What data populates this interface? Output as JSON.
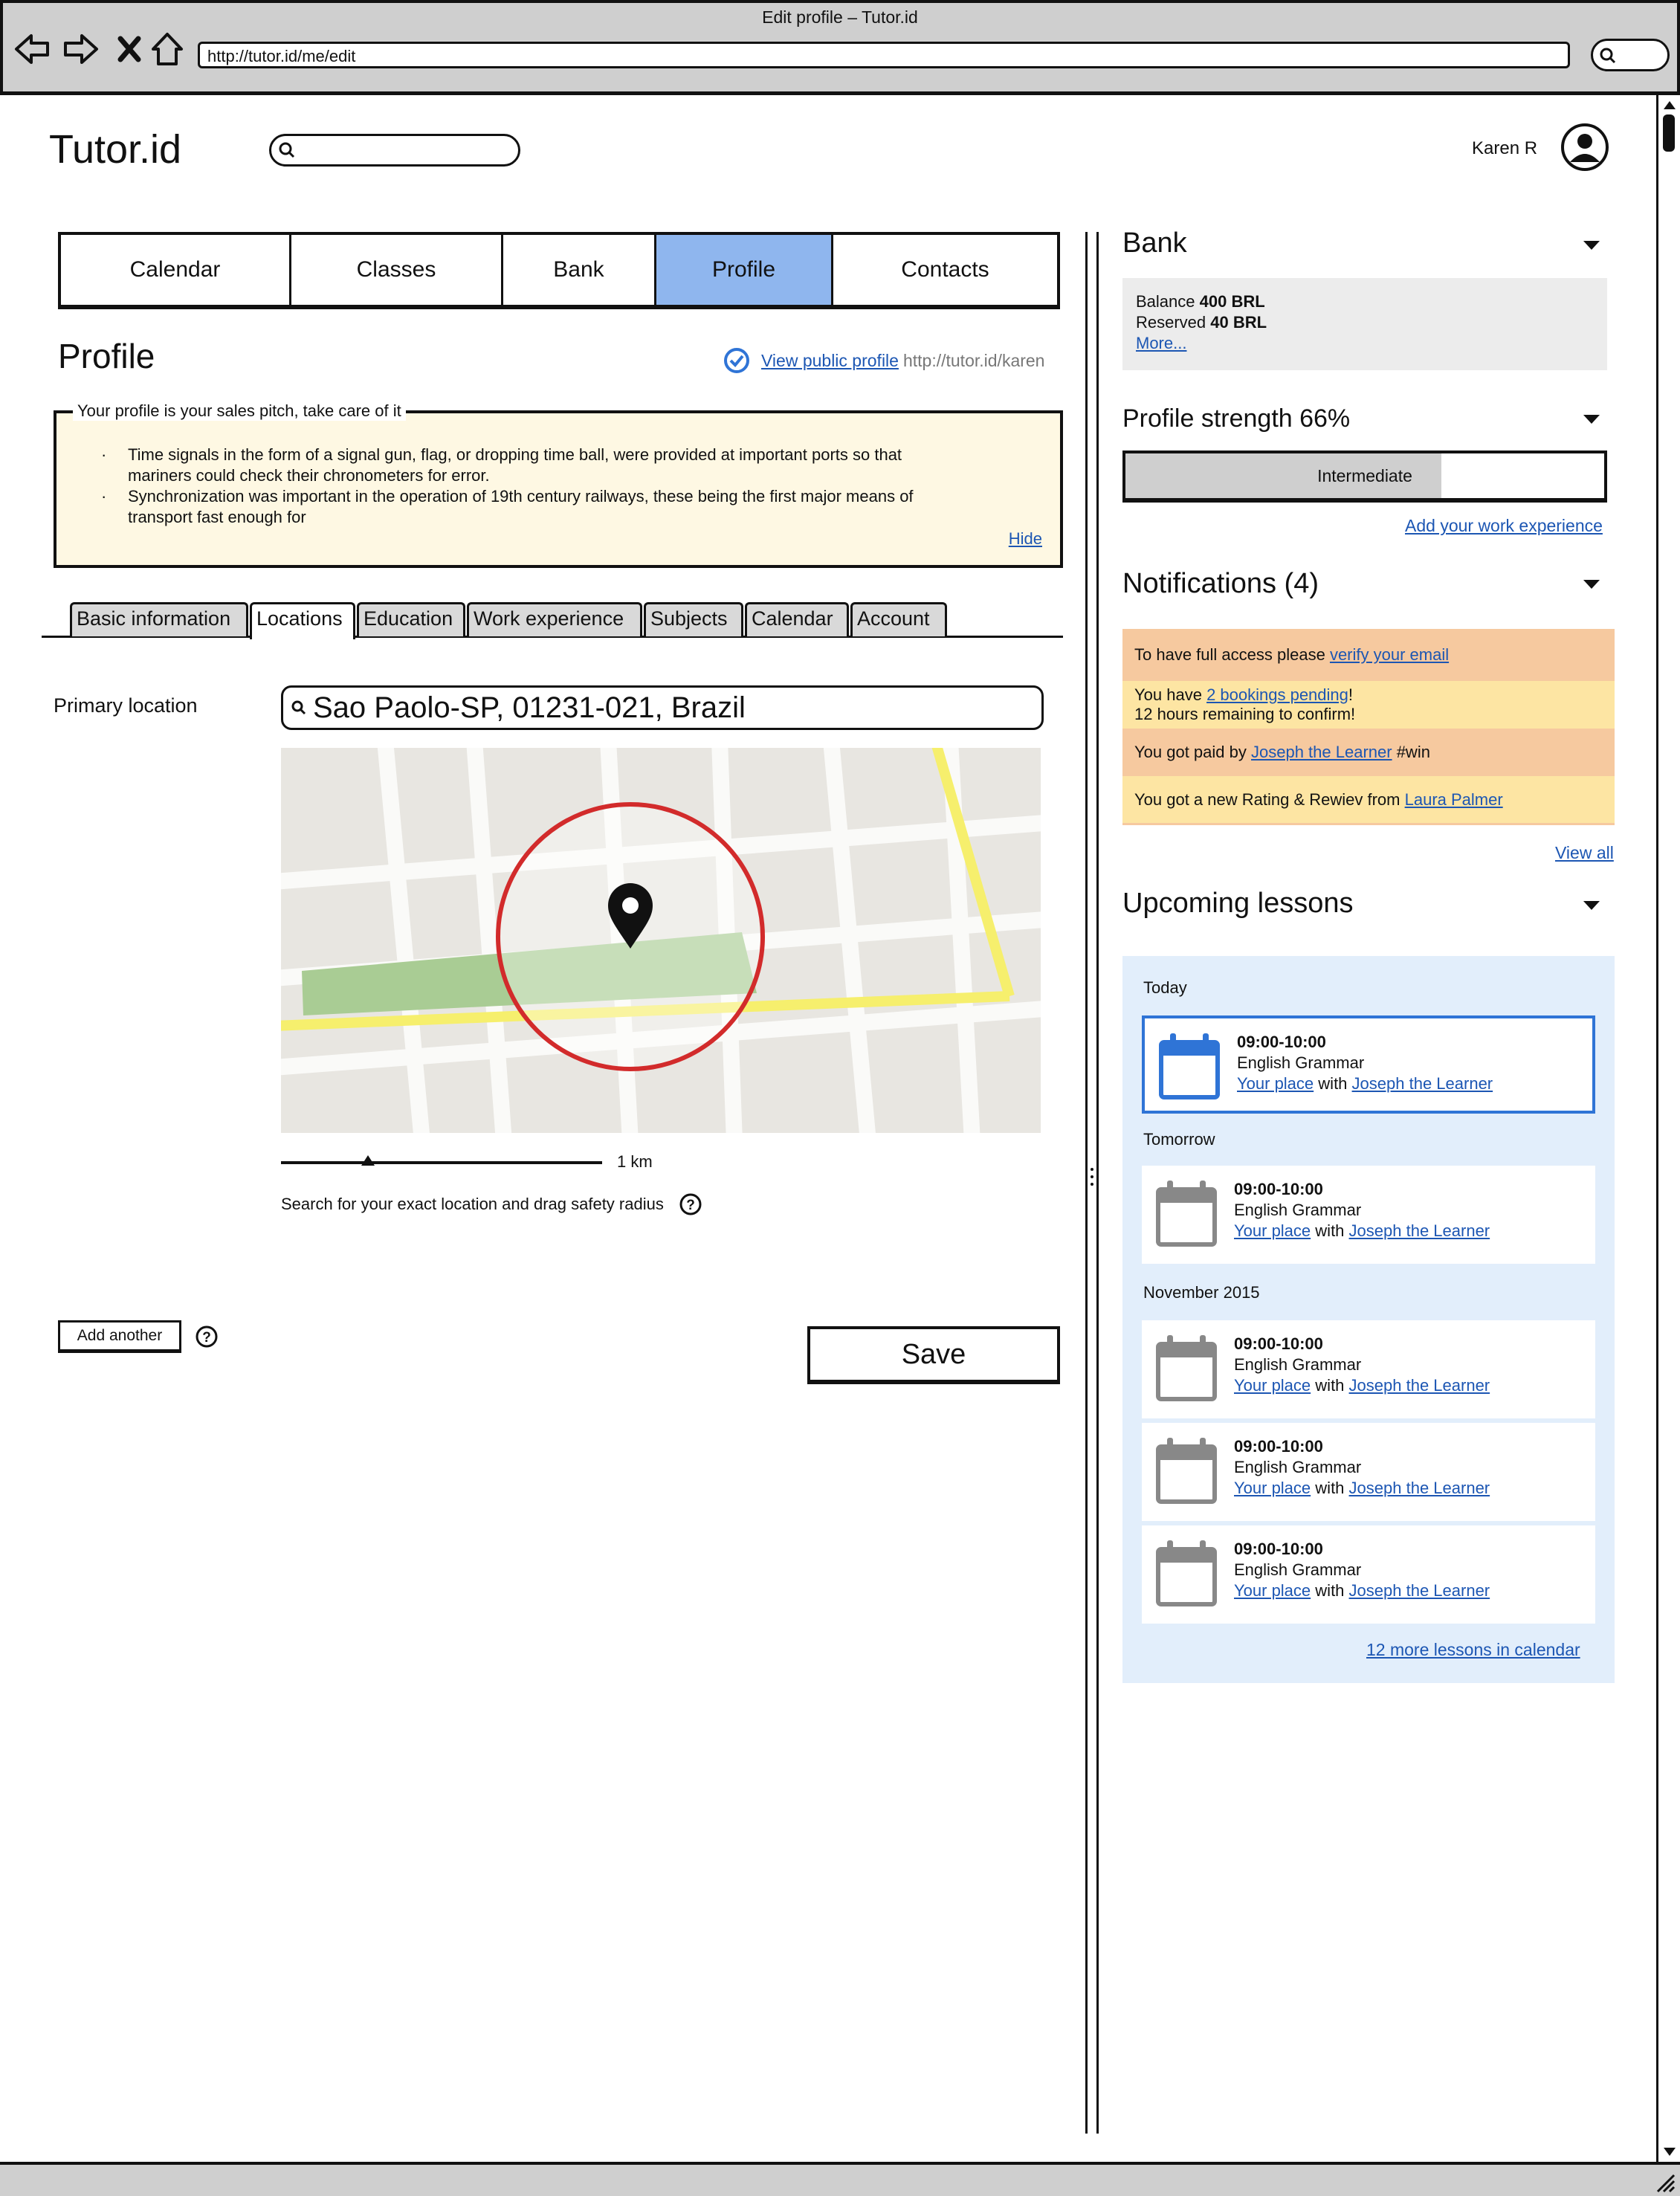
{
  "window": {
    "title": "Edit profile – Tutor.id",
    "url": "http://tutor.id/me/edit"
  },
  "header": {
    "logo": "Tutor.id",
    "search_placeholder": "",
    "user_name": "Karen R"
  },
  "main_nav": [
    {
      "label": "Calendar",
      "active": false
    },
    {
      "label": "Classes",
      "active": false
    },
    {
      "label": "Bank",
      "active": false
    },
    {
      "label": "Profile",
      "active": true
    },
    {
      "label": "Contacts",
      "active": false
    }
  ],
  "profile": {
    "title": "Profile",
    "view_public_label": "View public profile",
    "public_url": "http://tutor.id/karen"
  },
  "info_box": {
    "legend": "Your profile is your sales pitch, take care of it",
    "items": [
      "Time signals in the form of a signal gun, flag, or dropping time ball, were provided at important ports so that mariners could check their chronometers for error.",
      "Synchronization was important in the operation of 19th century railways, these being the first major means of transport fast enough for"
    ],
    "hide_label": "Hide"
  },
  "sub_tabs": [
    {
      "label": "Basic information",
      "active": false
    },
    {
      "label": "Locations",
      "active": true
    },
    {
      "label": "Education",
      "active": false
    },
    {
      "label": "Work experience",
      "active": false
    },
    {
      "label": "Subjects",
      "active": false
    },
    {
      "label": "Calendar",
      "active": false
    },
    {
      "label": "Account",
      "active": false
    }
  ],
  "location": {
    "label": "Primary location",
    "value": "Sao Paolo-SP, 01231-021, Brazil",
    "scale_label": "1 km",
    "hint": "Search for your exact location and drag safety radius"
  },
  "actions": {
    "add_another": "Add another",
    "save": "Save"
  },
  "sidebar": {
    "bank": {
      "title": "Bank",
      "balance_label": "Balance",
      "balance_value": "400 BRL",
      "reserved_label": "Reserved",
      "reserved_value": "40 BRL",
      "more_label": "More..."
    },
    "strength": {
      "title": "Profile strength 66%",
      "level": "Intermediate",
      "percent": 66,
      "add_work_label": "Add your work experience"
    },
    "notifications": {
      "title": "Notifications (4)",
      "items": [
        {
          "pre": "To have full access please ",
          "link": "verify your email",
          "post": "",
          "line2": "",
          "color": "#f6c99f"
        },
        {
          "pre": "You have ",
          "link": "2 bookings pending",
          "post": "!",
          "line2": "12 hours remaining to confirm!",
          "color": "#fde5a3"
        },
        {
          "pre": "You got paid by ",
          "link": "Joseph the Learner",
          "post": " #win",
          "line2": "",
          "color": "#f6c99f"
        },
        {
          "pre": "You got a new Rating & Rewiev from ",
          "link": "Laura Palmer",
          "post": "",
          "line2": "",
          "color": "#fde5a3"
        }
      ],
      "view_all_label": "View all"
    },
    "lessons": {
      "title": "Upcoming lessons",
      "groups": [
        {
          "label": "Today"
        },
        {
          "label": "Tomorrow"
        },
        {
          "label": "November 2015"
        }
      ],
      "items": [
        {
          "time": "09:00-10:00",
          "subject": "English Grammar",
          "place": "Your place",
          "with": "with",
          "student": "Joseph the Learner"
        },
        {
          "time": "09:00-10:00",
          "subject": "English Grammar",
          "place": "Your place",
          "with": "with",
          "student": "Joseph the Learner"
        },
        {
          "time": "09:00-10:00",
          "subject": "English Grammar",
          "place": "Your place",
          "with": "with",
          "student": "Joseph the Learner"
        },
        {
          "time": "09:00-10:00",
          "subject": "English Grammar",
          "place": "Your place",
          "with": "with",
          "student": "Joseph the Learner"
        },
        {
          "time": "09:00-10:00",
          "subject": "English Grammar",
          "place": "Your place",
          "with": "with",
          "student": "Joseph the Learner"
        }
      ],
      "more_label": "12 more lessons in calendar"
    }
  },
  "colors": {
    "active_tab": "#8fb6ee",
    "info_bg": "#fef8e3",
    "link": "#1c56b3",
    "lessons_bg": "#e2eefb",
    "current_lesson_border": "#2f74d6",
    "radius_circle": "#d22b2b"
  }
}
